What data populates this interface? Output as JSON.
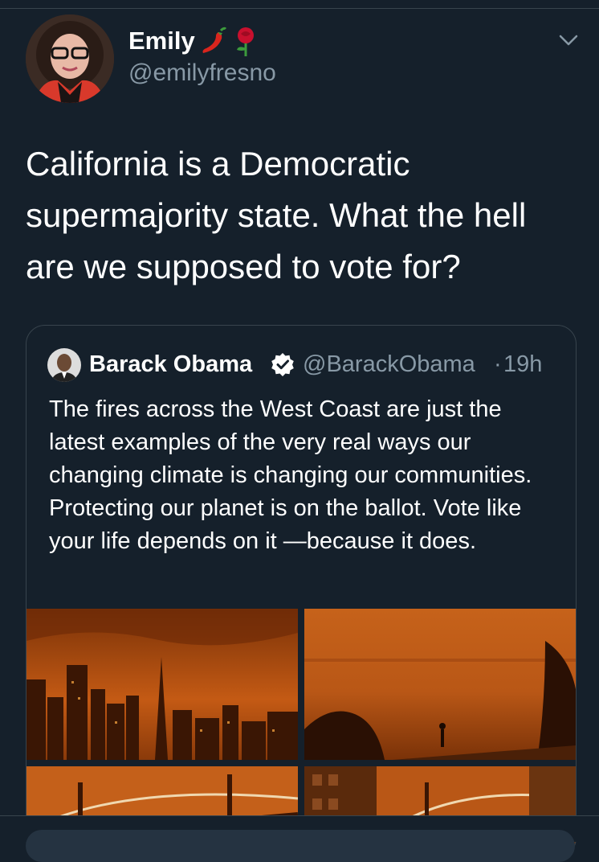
{
  "tweet": {
    "author": {
      "display_name": "Emily",
      "handle": "@emilyfresno",
      "name_emojis": [
        "hot-pepper-emoji",
        "rose-emoji"
      ]
    },
    "text": "California is a Democratic supermajority state. What the hell are we supposed to vote for?",
    "menu_icon": "chevron-down-icon"
  },
  "quoted_tweet": {
    "author": {
      "display_name": "Barack Obama",
      "verified": true,
      "handle": "@BarackObama"
    },
    "separator": "·",
    "time": "19h",
    "text": "The fires across the West Coast are just the latest examples of the very real ways our changing climate is changing our communities. Protecting our planet is on the ballot. Vote like your life depends on it —because it does.",
    "photos": [
      "city-skyline-orange-sky",
      "bay-view-orange-sky",
      "bay-bridge-orange-sky",
      "bay-bridge-buildings-orange-sky"
    ]
  },
  "colors": {
    "background": "#15202b",
    "secondary_text": "#8899a6",
    "border": "#38444d",
    "accent": "#1da1f2"
  }
}
